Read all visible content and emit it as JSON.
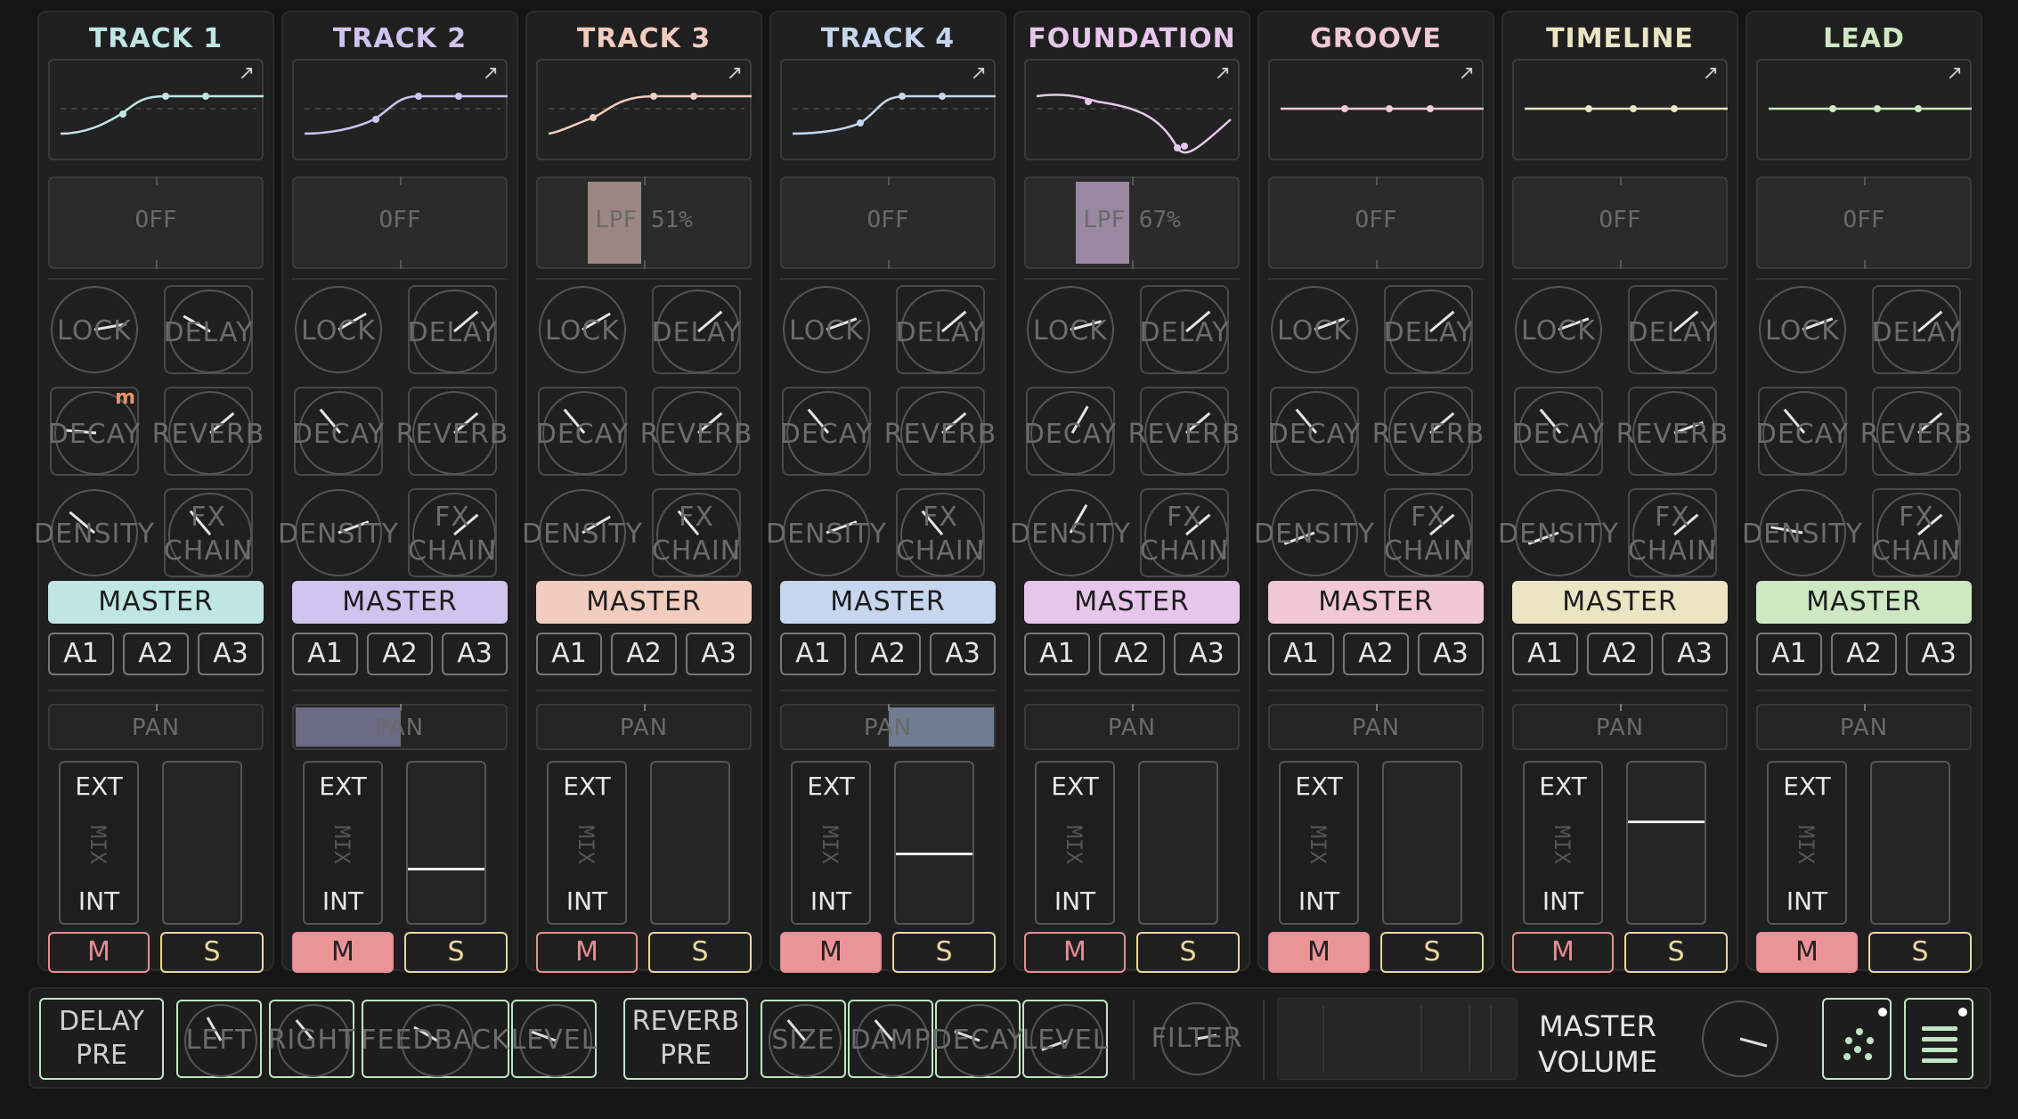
{
  "tracks": [
    {
      "title": "TRACK 1",
      "color": "#bfe6e3",
      "filter": "OFF",
      "filter_on": false,
      "master": "MASTER",
      "aux": [
        "A1",
        "A2",
        "A3"
      ],
      "pan": "PAN",
      "pan_fill": null,
      "mix_ext": "EXT",
      "mix_label": "MIX",
      "mix_int": "INT",
      "fader": null,
      "mute": "M",
      "mute_on": false,
      "solo": "S",
      "mod_marker": "m"
    },
    {
      "title": "TRACK 2",
      "color": "#cfc4ee",
      "filter": "OFF",
      "filter_on": false,
      "master": "MASTER",
      "aux": [
        "A1",
        "A2",
        "A3"
      ],
      "pan": "PAN",
      "pan_fill": "left",
      "mix_ext": "EXT",
      "mix_label": "MIX",
      "mix_int": "INT",
      "fader": 0.33,
      "mute": "M",
      "mute_on": true,
      "solo": "S",
      "mod_marker": ""
    },
    {
      "title": "TRACK 3",
      "color": "#f2cdbf",
      "filter": "LPF 51%",
      "filter_on": true,
      "master": "MASTER",
      "aux": [
        "A1",
        "A2",
        "A3"
      ],
      "pan": "PAN",
      "pan_fill": null,
      "mix_ext": "EXT",
      "mix_label": "MIX",
      "mix_int": "INT",
      "fader": null,
      "mute": "M",
      "mute_on": false,
      "solo": "S",
      "mod_marker": ""
    },
    {
      "title": "TRACK 4",
      "color": "#c6d6ef",
      "filter": "OFF",
      "filter_on": false,
      "master": "MASTER",
      "aux": [
        "A1",
        "A2",
        "A3"
      ],
      "pan": "PAN",
      "pan_fill": "right",
      "mix_ext": "EXT",
      "mix_label": "MIX",
      "mix_int": "INT",
      "fader": 0.42,
      "mute": "M",
      "mute_on": true,
      "solo": "S",
      "mod_marker": ""
    },
    {
      "title": "FOUNDATION",
      "color": "#e7c6ec",
      "filter": "LPF 67%",
      "filter_on": true,
      "master": "MASTER",
      "aux": [
        "A1",
        "A2",
        "A3"
      ],
      "pan": "PAN",
      "pan_fill": null,
      "mix_ext": "EXT",
      "mix_label": "MIX",
      "mix_int": "INT",
      "fader": null,
      "mute": "M",
      "mute_on": false,
      "solo": "S",
      "mod_marker": ""
    },
    {
      "title": "GROOVE",
      "color": "#f2c8d6",
      "filter": "OFF",
      "filter_on": false,
      "master": "MASTER",
      "aux": [
        "A1",
        "A2",
        "A3"
      ],
      "pan": "PAN",
      "pan_fill": null,
      "mix_ext": "EXT",
      "mix_label": "MIX",
      "mix_int": "INT",
      "fader": null,
      "mute": "M",
      "mute_on": true,
      "solo": "S",
      "mod_marker": ""
    },
    {
      "title": "TIMELINE",
      "color": "#ebe5c4",
      "filter": "OFF",
      "filter_on": false,
      "master": "MASTER",
      "aux": [
        "A1",
        "A2",
        "A3"
      ],
      "pan": "PAN",
      "pan_fill": null,
      "mix_ext": "EXT",
      "mix_label": "MIX",
      "mix_int": "INT",
      "fader": 0.62,
      "mute": "M",
      "mute_on": false,
      "solo": "S",
      "mod_marker": ""
    },
    {
      "title": "LEAD",
      "color": "#cde8c2",
      "filter": "OFF",
      "filter_on": false,
      "master": "MASTER",
      "aux": [
        "A1",
        "A2",
        "A3"
      ],
      "pan": "PAN",
      "pan_fill": null,
      "mix_ext": "EXT",
      "mix_label": "MIX",
      "mix_int": "INT",
      "fader": null,
      "mute": "M",
      "mute_on": true,
      "solo": "S",
      "mod_marker": ""
    }
  ],
  "knob_labels": {
    "lock": "LOCK",
    "delay": "DELAY",
    "decay": "DECAY",
    "reverb": "REVERB",
    "density": "DENSITY",
    "fx_top": "FX",
    "fx_bottom": "CHAIN"
  },
  "bottom": {
    "delay_pre_top": "DELAY",
    "delay_pre_bottom": "PRE",
    "delay_knobs": [
      "LEFT",
      "RIGHT",
      "FEEDBACK",
      "LEVEL"
    ],
    "reverb_pre_top": "REVERB",
    "reverb_pre_bottom": "PRE",
    "reverb_knobs": [
      "SIZE",
      "DAMP",
      "DECAY",
      "LEVEL"
    ],
    "filter": "FILTER",
    "master_top": "MASTER",
    "master_bottom": "VOLUME"
  },
  "icons": {
    "curve": "expand-arrow-icon",
    "dots": "dots-icon",
    "menu": "menu-icon"
  }
}
